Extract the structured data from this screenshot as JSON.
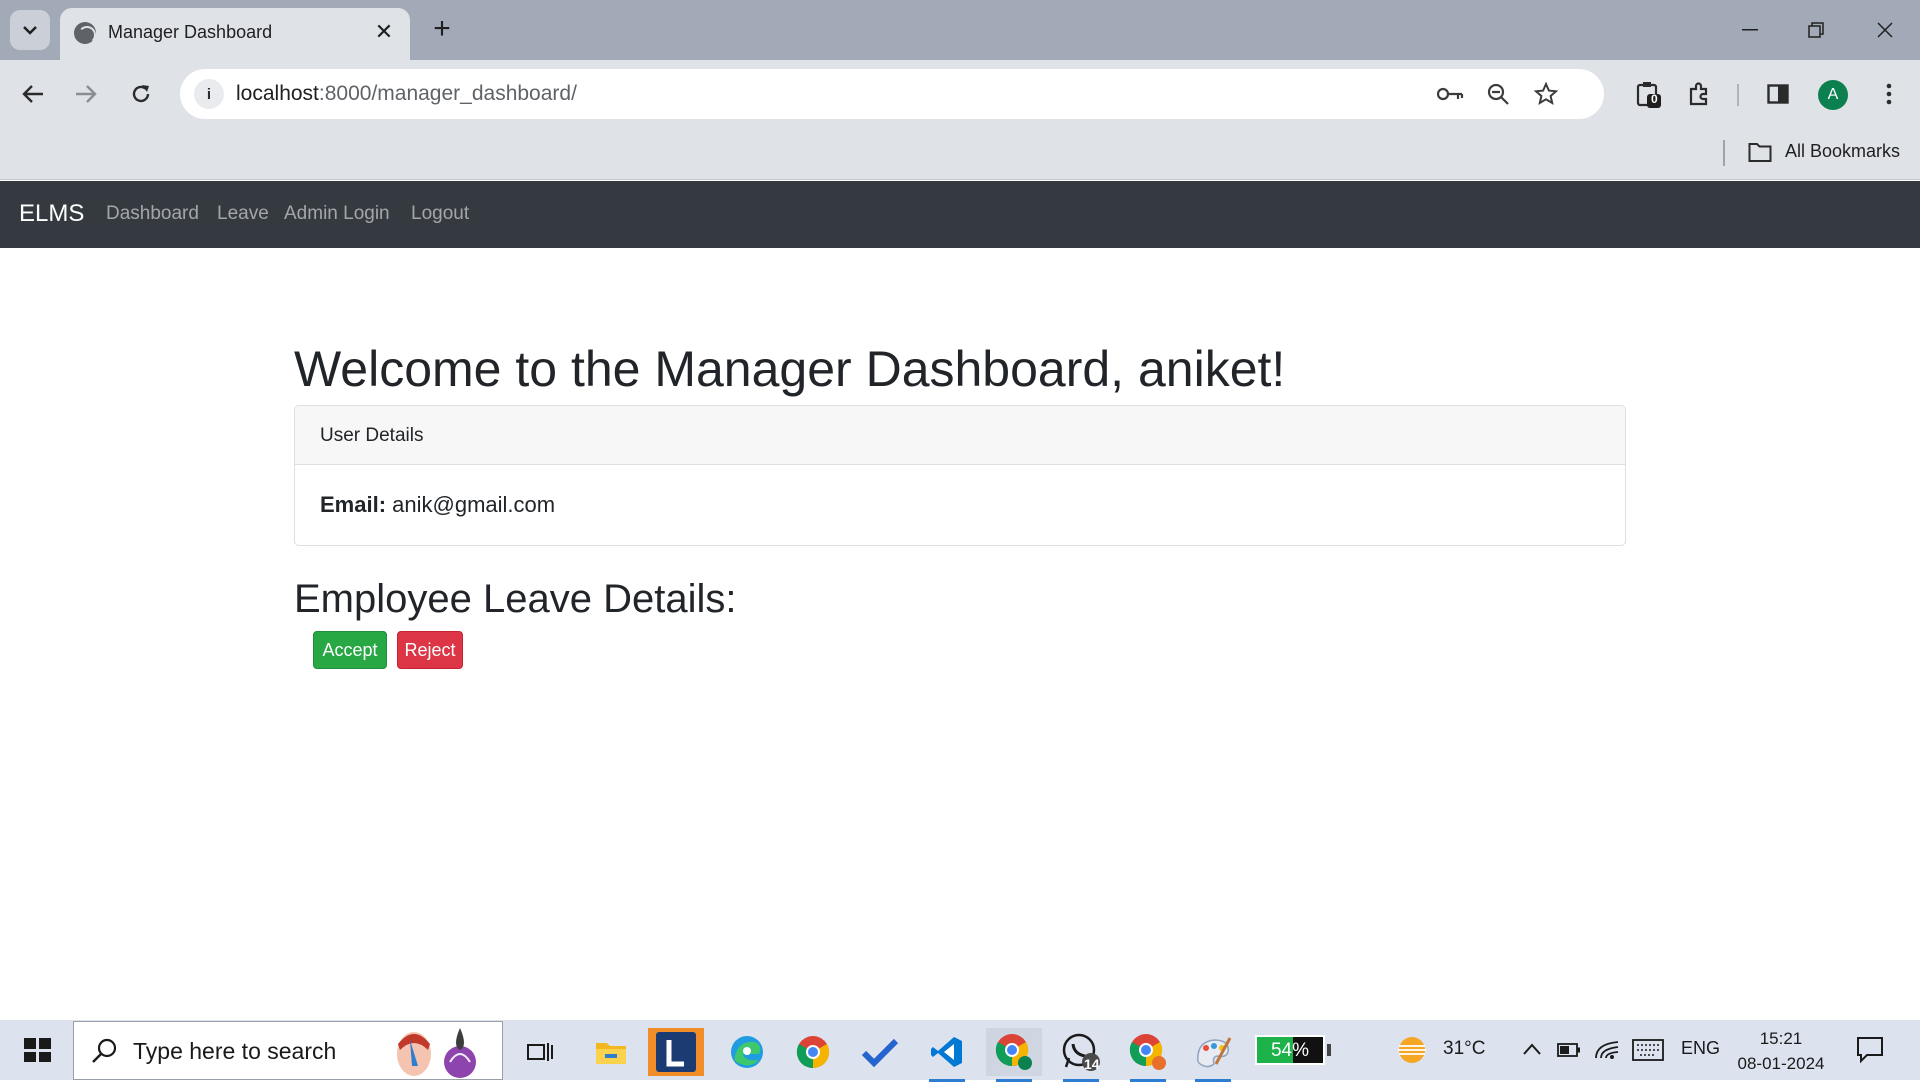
{
  "browser": {
    "tab_title": "Manager Dashboard",
    "url_host": "localhost",
    "url_path": ":8000/manager_dashboard/",
    "extensions_badge": "0",
    "profile_initial": "A",
    "bookmarks_label": "All Bookmarks"
  },
  "navbar": {
    "brand": "ELMS",
    "links": [
      "Dashboard",
      "Leave",
      "Admin Login",
      "Logout"
    ]
  },
  "main": {
    "heading": "Welcome to the Manager Dashboard, aniket!",
    "card": {
      "header": "User Details",
      "email_label": "Email:",
      "email_value": "anik@gmail.com"
    },
    "leave_heading": "Employee Leave Details:",
    "accept_label": "Accept",
    "reject_label": "Reject"
  },
  "taskbar": {
    "search_placeholder": "Type here to search",
    "whatsapp_badge": "14",
    "battery": "54%",
    "temperature": "31°C",
    "language": "ENG",
    "time": "15:21",
    "date": "08-01-2024"
  },
  "colors": {
    "navbar": "#343a40",
    "accept": "#28a745",
    "reject": "#dc3545",
    "tabstrip": "#a3aab7",
    "toolbar": "#dfe2e7"
  }
}
